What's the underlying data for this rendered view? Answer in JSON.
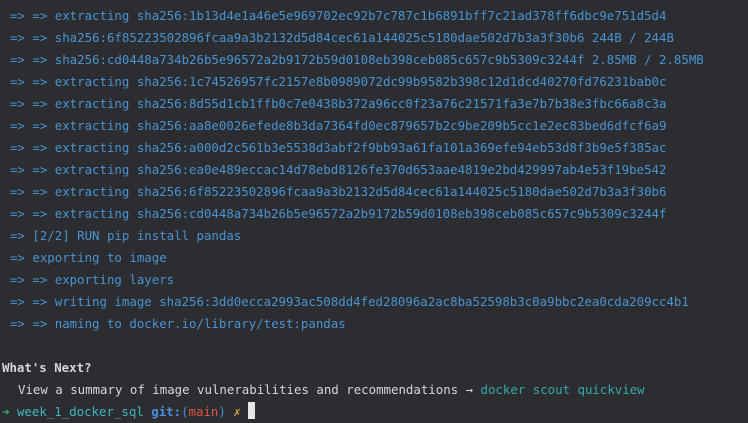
{
  "build_log": [
    "=> => extracting sha256:1b13d4e1a46e5e969702ec92b7c787c1b6891bff7c21ad378ff6dbc9e751d5d4",
    "=> => sha256:6f85223502896fcaa9a3b2132d5d84cec61a144025c5180dae502d7b3a3f30b6 244B / 244B",
    "=> => sha256:cd0448a734b26b5e96572a2b9172b59d0108eb398ceb085c657c9b5309c3244f 2.85MB / 2.85MB",
    "=> => extracting sha256:1c74526957fc2157e8b0989072dc99b9582b398c12d1dcd40270fd76231bab0c",
    "=> => extracting sha256:8d55d1cb1ffb0c7e0438b372a96cc0f23a76c21571fa3e7b7b38e3fbc66a8c3a",
    "=> => extracting sha256:aa8e0026efede8b3da7364fd0ec879657b2c9be209b5cc1e2ec83bed6dfcf6a9",
    "=> => extracting sha256:a000d2c561b3e5538d3abf2f9bb93a61fa101a369efe94eb53d8f3b9e5f385ac",
    "=> => extracting sha256:ea0e489eccac14d78ebd8126fe370d653aae4819e2bd429997ab4e53f19be542",
    "=> => extracting sha256:6f85223502896fcaa9a3b2132d5d84cec61a144025c5180dae502d7b3a3f30b6",
    "=> => extracting sha256:cd0448a734b26b5e96572a2b9172b59d0108eb398ceb085c657c9b5309c3244f",
    "=> [2/2] RUN pip install pandas",
    "=> exporting to image",
    "=> => exporting layers",
    "=> => writing image sha256:3dd0ecca2993ac508dd4fed28096a2ac8ba52598b3c0a9bbc2ea0cda209cc4b1",
    "=> => naming to docker.io/library/test:pandas"
  ],
  "whats_next": {
    "title": "What's Next?",
    "hint_text": "View a summary of image vulnerabilities and recommendations → ",
    "hint_command": "docker scout quickview"
  },
  "prompt": {
    "arrow": "➜",
    "directory": "week_1_docker_sql",
    "git_label": "git:",
    "paren_open": "(",
    "branch": "main",
    "paren_close": ")",
    "dirty_marker": "✗"
  },
  "colors": {
    "background": "#2b2d30",
    "build_text": "#4a93d1",
    "default_text": "#d3d6db",
    "command": "#3aa8a8",
    "prompt_arrow": "#3cb371",
    "directory": "#3fb6bf",
    "git_label": "#4a8fe0",
    "branch": "#e0534a",
    "dirty_marker": "#d9a441"
  }
}
